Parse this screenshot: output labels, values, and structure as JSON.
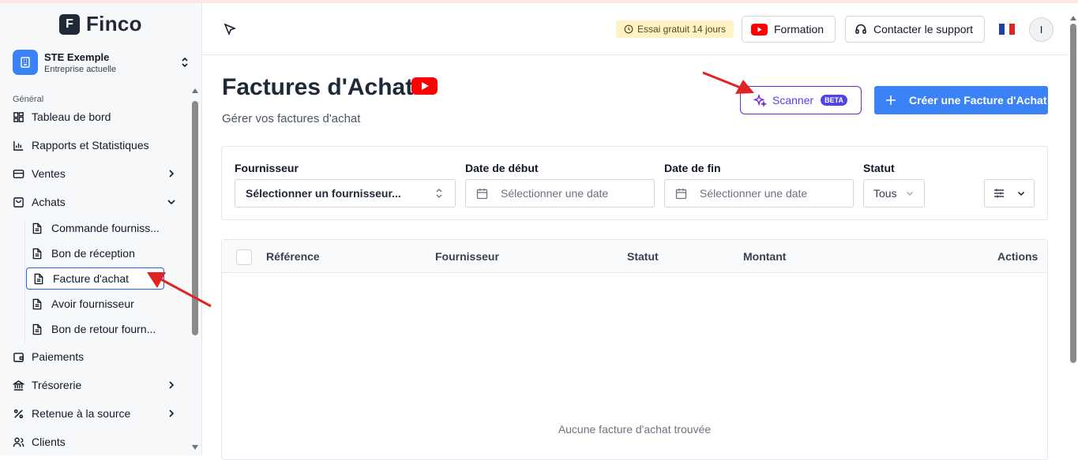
{
  "app": {
    "name": "Finco",
    "logo_letter": "F"
  },
  "company": {
    "name": "STE Exemple",
    "subtitle": "Entreprise actuelle"
  },
  "sidebar": {
    "section_label": "Général",
    "items": [
      {
        "label": "Tableau de bord",
        "icon": "dashboard-icon"
      },
      {
        "label": "Rapports et Statistiques",
        "icon": "chart-icon"
      },
      {
        "label": "Ventes",
        "icon": "card-icon",
        "expand": "chevron-right"
      },
      {
        "label": "Achats",
        "icon": "bag-icon",
        "expand": "chevron-down"
      },
      {
        "label": "Paiements",
        "icon": "wallet-icon"
      },
      {
        "label": "Trésorerie",
        "icon": "bank-icon",
        "expand": "chevron-right"
      },
      {
        "label": "Retenue à la source",
        "icon": "percent-icon",
        "expand": "chevron-right"
      },
      {
        "label": "Clients",
        "icon": "users-icon"
      }
    ],
    "achats_sub": [
      {
        "label": "Commande fourniss..."
      },
      {
        "label": "Bon de réception"
      },
      {
        "label": "Facture d'achat",
        "active": true
      },
      {
        "label": "Avoir fournisseur"
      },
      {
        "label": "Bon de retour fourn..."
      }
    ]
  },
  "header": {
    "trial": "Essai gratuit 14 jours",
    "formation": "Formation",
    "support": "Contacter le support",
    "avatar": "I",
    "language_flag": "fr-flag-icon"
  },
  "main": {
    "title": "Factures d'Achat",
    "subtitle": "Gérer vos factures d'achat",
    "scanner": "Scanner",
    "scanner_badge": "BETA",
    "create": "Créer une Facture d'Achat"
  },
  "filters": {
    "supplier_label": "Fournisseur",
    "supplier_value": "Sélectionner un fournisseur...",
    "start_label": "Date de début",
    "start_placeholder": "Sélectionner une date",
    "end_label": "Date de fin",
    "end_placeholder": "Sélectionner une date",
    "status_label": "Statut",
    "status_value": "Tous"
  },
  "table": {
    "columns": [
      "Référence",
      "Fournisseur",
      "Statut",
      "Montant",
      "Actions"
    ],
    "empty": "Aucune facture d'achat trouvée"
  },
  "colors": {
    "accent": "#3b82f6",
    "scanner": "#4f46e5",
    "annotation": "#e02424",
    "youtube": "#ff0000"
  }
}
